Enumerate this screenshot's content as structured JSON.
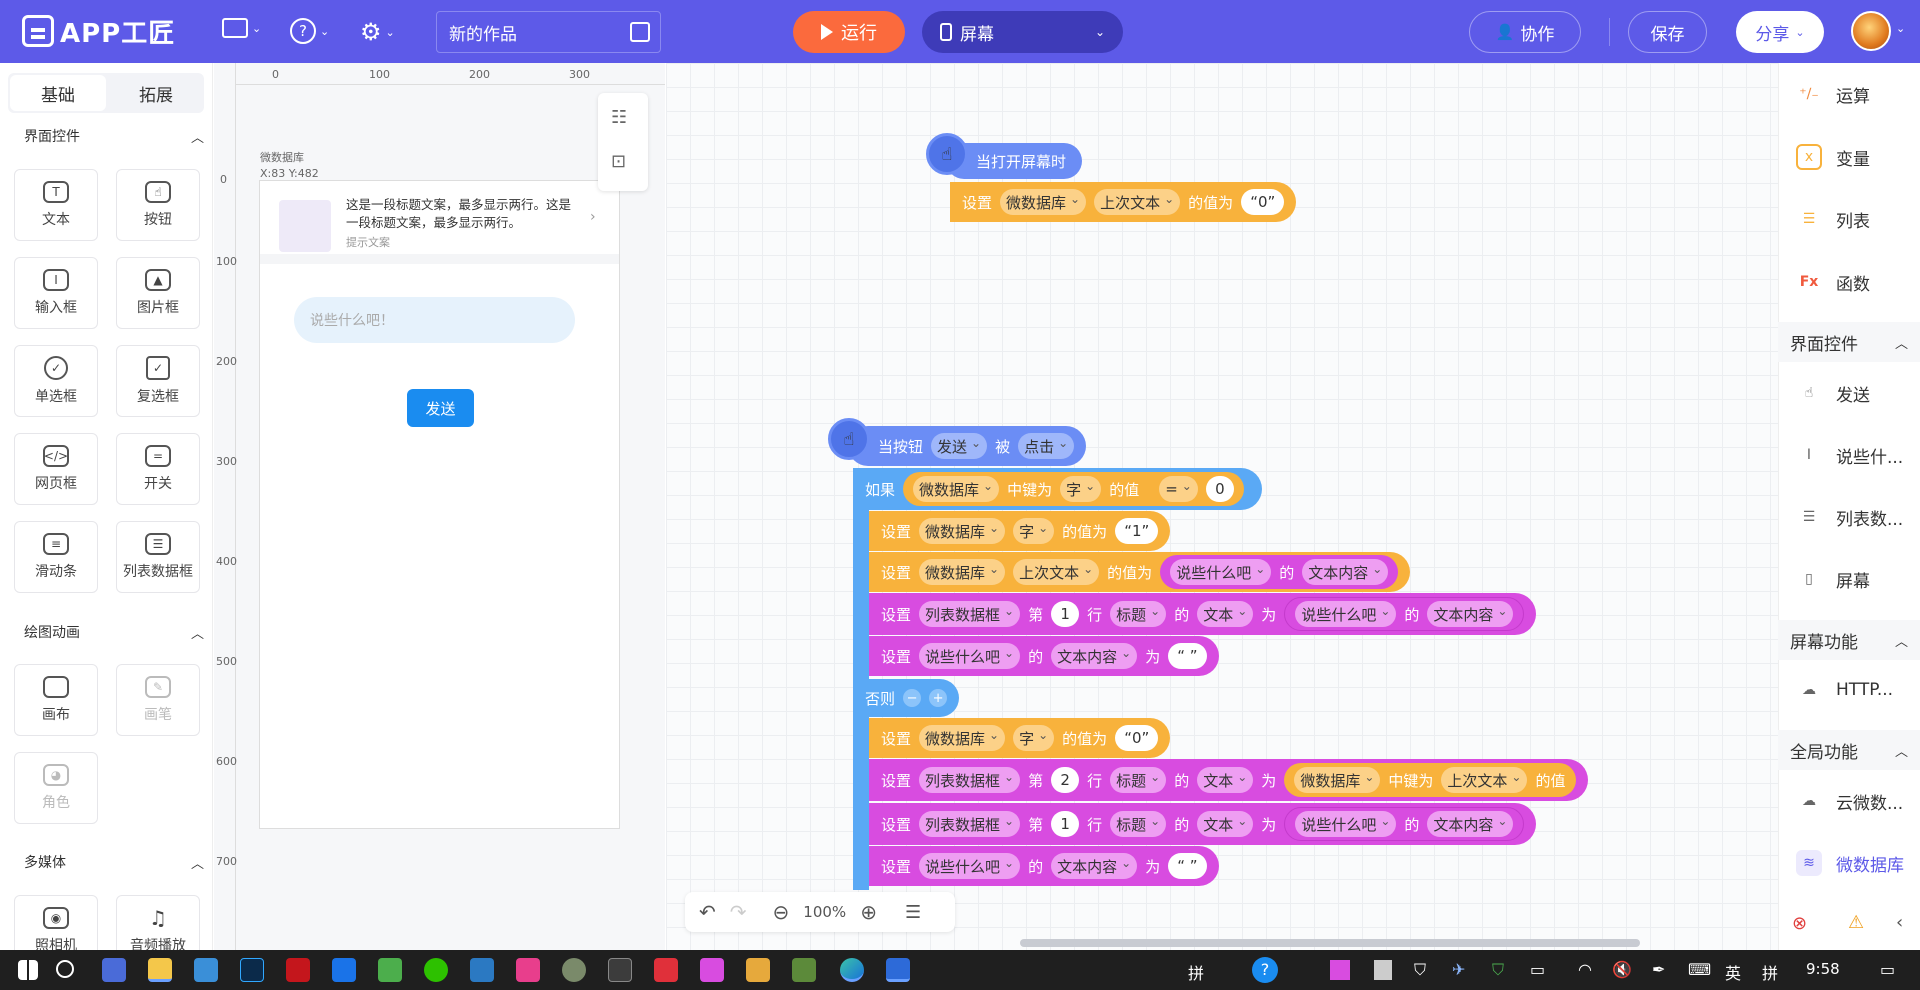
{
  "app": {
    "logo_text": "APP工匠",
    "project_title": "新的作品",
    "run_label": "运行",
    "screen_label": "屏幕",
    "collab_label": "协作",
    "save_label": "保存",
    "share_label": "分享"
  },
  "left": {
    "tabs": [
      "基础",
      "拓展"
    ],
    "sections": [
      {
        "title": "界面控件",
        "items": [
          "文本",
          "按钮",
          "输入框",
          "图片框",
          "单选框",
          "复选框",
          "网页框",
          "开关",
          "滑动条",
          "列表数据框"
        ]
      },
      {
        "title": "绘图动画",
        "items": [
          "画布",
          "画笔",
          "角色"
        ]
      },
      {
        "title": "多媒体",
        "items": [
          "照相机",
          "音频播放"
        ]
      }
    ]
  },
  "canvas": {
    "ruler_h": [
      "0",
      "100",
      "200",
      "300"
    ],
    "ruler_v": [
      "0",
      "100",
      "200",
      "300",
      "400",
      "500",
      "600",
      "700"
    ],
    "db_label": "微数据库",
    "coords": "X:83 Y:482",
    "list_title": "这是一段标题文案，最多显示两行。这是一段标题文案，最多显示两行。",
    "list_hint": "提示文案",
    "input_placeholder": "说些什么吧！",
    "send_button": "发送"
  },
  "blocks": {
    "ev1": {
      "text": "当打开屏幕时"
    },
    "ev1_set": {
      "set": "设置",
      "db": "微数据库",
      "key": "上次文本",
      "val_label": "的值为",
      "value": "“0”"
    },
    "ev2": {
      "prefix": "当按钮",
      "btn": "发送",
      "by": "被",
      "action": "点击"
    },
    "if": {
      "label": "如果",
      "db": "微数据库",
      "key_label": "中键为",
      "key": "字",
      "val_label": "的值",
      "op": "=",
      "value": "0"
    },
    "r1": {
      "set": "设置",
      "db": "微数据库",
      "key": "字",
      "val_label": "的值为",
      "value": "“1”"
    },
    "r2": {
      "set": "设置",
      "db": "微数据库",
      "key": "上次文本",
      "val_label": "的值为",
      "comp": "说些什么吧",
      "of": "的",
      "prop": "文本内容"
    },
    "r3": {
      "set": "设置",
      "comp": "列表数据框",
      "nth": "第",
      "row": "1",
      "row_label": "行",
      "field": "标题",
      "of": "的",
      "prop": "文本",
      "as": "为",
      "comp2": "说些什么吧",
      "of2": "的",
      "prop2": "文本内容"
    },
    "r4": {
      "set": "设置",
      "comp": "说些什么吧",
      "of": "的",
      "prop": "文本内容",
      "as": "为",
      "value": "“ ”"
    },
    "else": {
      "label": "否则"
    },
    "r5": {
      "set": "设置",
      "db": "微数据库",
      "key": "字",
      "val_label": "的值为",
      "value": "“0”"
    },
    "r6": {
      "set": "设置",
      "comp": "列表数据框",
      "nth": "第",
      "row": "2",
      "row_label": "行",
      "field": "标题",
      "of": "的",
      "prop": "文本",
      "as": "为",
      "db": "微数据库",
      "key_label": "中键为",
      "key": "上次文本",
      "val_label": "的值"
    },
    "r7": {
      "set": "设置",
      "comp": "列表数据框",
      "nth": "第",
      "row": "1",
      "row_label": "行",
      "field": "标题",
      "of": "的",
      "prop": "文本",
      "as": "为",
      "comp2": "说些什么吧",
      "of2": "的",
      "prop2": "文本内容"
    },
    "r8": {
      "set": "设置",
      "comp": "说些什么吧",
      "of": "的",
      "prop": "文本内容",
      "as": "为",
      "value": "“ ”"
    }
  },
  "zoom": "100%",
  "right": {
    "items1": [
      "运算",
      "变量",
      "列表",
      "函数"
    ],
    "sec1": "界面控件",
    "items2": [
      "发送",
      "说些什...",
      "列表数...",
      "屏幕"
    ],
    "sec2": "屏幕功能",
    "items3": [
      "HTTP..."
    ],
    "sec3": "全局功能",
    "items4": [
      "云微数...",
      "微数据库"
    ]
  },
  "taskbar": {
    "ime1": "拼",
    "ime2": "英",
    "ime3": "拼",
    "clock": "9:58"
  },
  "colors": {
    "brand": "#5d5ae8",
    "run": "#fb6a3d",
    "event": "#6b8df5",
    "data": "#f8b23c",
    "ui": "#d84ce0",
    "control": "#5aa9f5"
  }
}
